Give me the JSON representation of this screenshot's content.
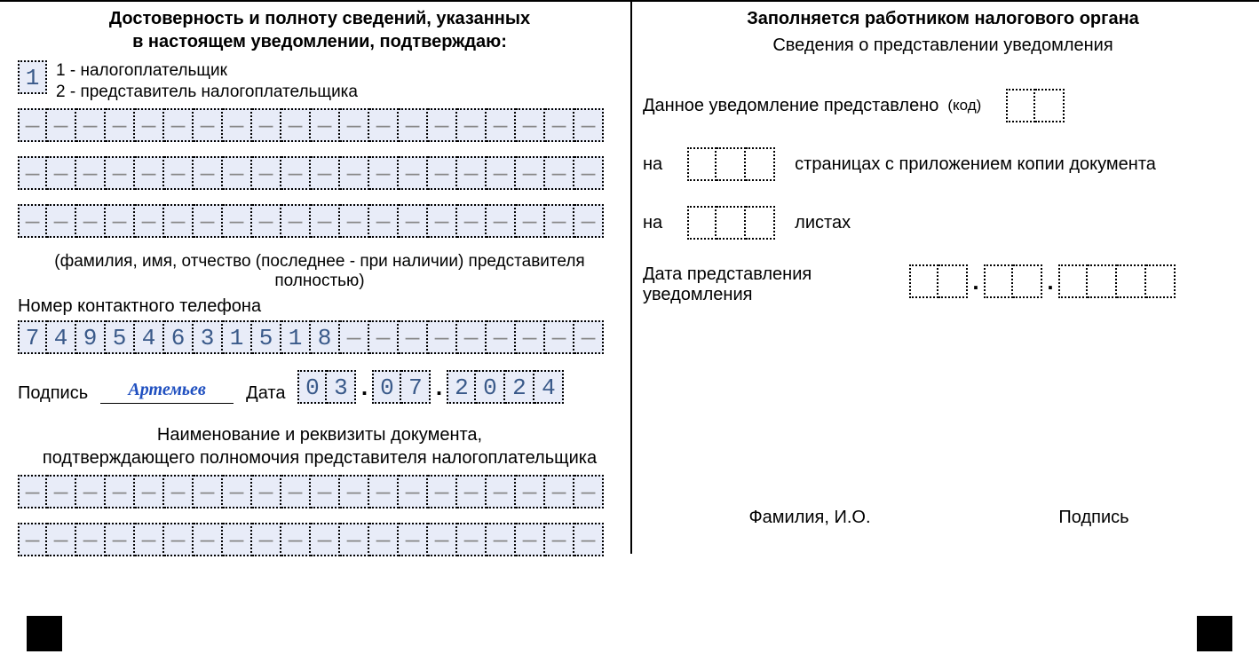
{
  "left": {
    "title_l1": "Достоверность и полноту сведений, указанных",
    "title_l2": "в настоящем уведомлении, подтверждаю:",
    "submitter_code": "1",
    "legend_1": "1 - налогоплательщик",
    "legend_2": "2 - представитель налогоплательщика",
    "name_rows": [
      [
        "—",
        "—",
        "—",
        "—",
        "—",
        "—",
        "—",
        "—",
        "—",
        "—",
        "—",
        "—",
        "—",
        "—",
        "—",
        "—",
        "—",
        "—",
        "—",
        "—"
      ],
      [
        "—",
        "—",
        "—",
        "—",
        "—",
        "—",
        "—",
        "—",
        "—",
        "—",
        "—",
        "—",
        "—",
        "—",
        "—",
        "—",
        "—",
        "—",
        "—",
        "—"
      ],
      [
        "—",
        "—",
        "—",
        "—",
        "—",
        "—",
        "—",
        "—",
        "—",
        "—",
        "—",
        "—",
        "—",
        "—",
        "—",
        "—",
        "—",
        "—",
        "—",
        "—"
      ]
    ],
    "name_note_l1": "(фамилия, имя, отчество (последнее - при наличии) представителя",
    "name_note_l2": "полностью)",
    "phone_label": "Номер контактного телефона",
    "phone": [
      "7",
      "4",
      "9",
      "5",
      "4",
      "6",
      "3",
      "1",
      "5",
      "1",
      "8",
      "—",
      "—",
      "—",
      "—",
      "—",
      "—",
      "—",
      "—",
      "—"
    ],
    "sig_label": "Подпись",
    "signature": "Артемьев",
    "date_label": "Дата",
    "date_dd": [
      "0",
      "3"
    ],
    "date_mm": [
      "0",
      "7"
    ],
    "date_yyyy": [
      "2",
      "0",
      "2",
      "4"
    ],
    "doc_title_l1": "Наименование и реквизиты документа,",
    "doc_title_l2": "подтверждающего полномочия представителя налогоплательщика",
    "doc_rows": [
      [
        "—",
        "—",
        "—",
        "—",
        "—",
        "—",
        "—",
        "—",
        "—",
        "—",
        "—",
        "—",
        "—",
        "—",
        "—",
        "—",
        "—",
        "—",
        "—",
        "—"
      ],
      [
        "—",
        "—",
        "—",
        "—",
        "—",
        "—",
        "—",
        "—",
        "—",
        "—",
        "—",
        "—",
        "—",
        "—",
        "—",
        "—",
        "—",
        "—",
        "—",
        "—"
      ]
    ]
  },
  "right": {
    "title": "Заполняется работником налогового органа",
    "subtitle": "Сведения о представлении уведомления",
    "presented_label": "Данное уведомление представлено",
    "code_hint": "(код)",
    "code_cells": 2,
    "on_label": "на",
    "pages_cells": 3,
    "pages_suffix": "страницах с приложением копии документа",
    "sheets_cells": 3,
    "sheets_suffix": "листах",
    "date_label_l1": "Дата представления",
    "date_label_l2": "уведомления",
    "date_dd_cells": 2,
    "date_mm_cells": 2,
    "date_yyyy_cells": 4,
    "sig_left": "Фамилия, И.О.",
    "sig_right": "Подпись"
  }
}
